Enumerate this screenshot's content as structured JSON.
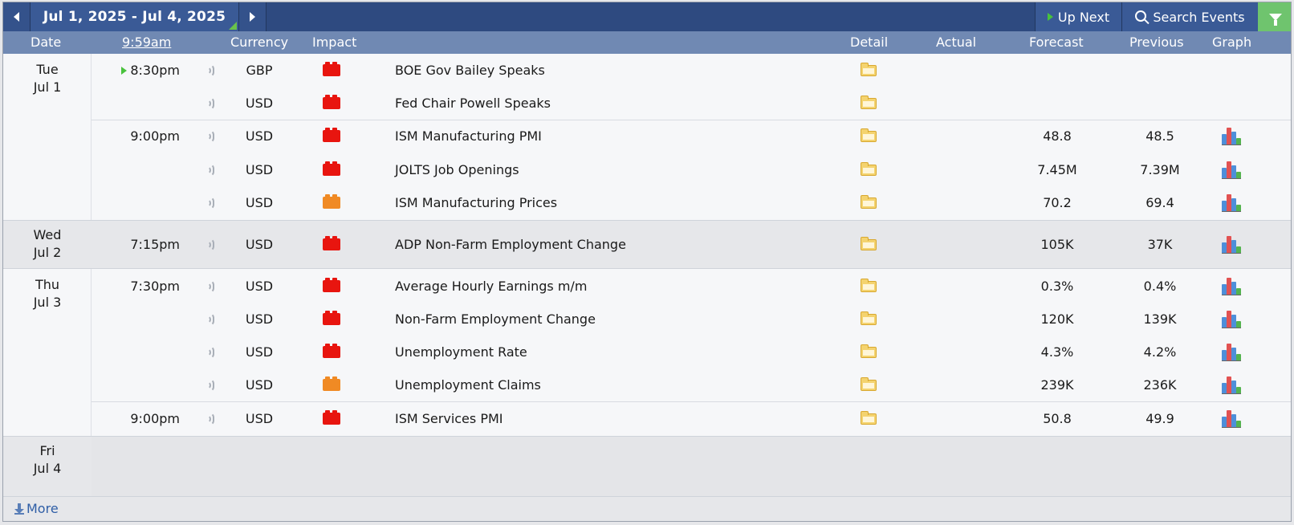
{
  "toolbar": {
    "date_range": "Jul 1, 2025 - Jul 4, 2025",
    "up_next": "Up Next",
    "search_events": "Search Events"
  },
  "header": {
    "date": "Date",
    "time": "9:59am",
    "currency": "Currency",
    "impact": "Impact",
    "detail": "Detail",
    "actual": "Actual",
    "forecast": "Forecast",
    "previous": "Previous",
    "graph": "Graph"
  },
  "days": [
    {
      "dow": "Tue",
      "date": "Jul 1"
    },
    {
      "dow": "Wed",
      "date": "Jul 2"
    },
    {
      "dow": "Thu",
      "date": "Jul 3"
    },
    {
      "dow": "Fri",
      "date": "Jul 4"
    }
  ],
  "events": [
    {
      "time": "8:30pm",
      "currency": "GBP",
      "impact": "high",
      "event": "BOE Gov Bailey Speaks",
      "actual": "",
      "forecast": "",
      "previous": "",
      "graph": false
    },
    {
      "time": "",
      "currency": "USD",
      "impact": "high",
      "event": "Fed Chair Powell Speaks",
      "actual": "",
      "forecast": "",
      "previous": "",
      "graph": false
    },
    {
      "time": "9:00pm",
      "currency": "USD",
      "impact": "high",
      "event": "ISM Manufacturing PMI",
      "actual": "",
      "forecast": "48.8",
      "previous": "48.5",
      "graph": true
    },
    {
      "time": "",
      "currency": "USD",
      "impact": "high",
      "event": "JOLTS Job Openings",
      "actual": "",
      "forecast": "7.45M",
      "previous": "7.39M",
      "graph": true
    },
    {
      "time": "",
      "currency": "USD",
      "impact": "medium",
      "event": "ISM Manufacturing Prices",
      "actual": "",
      "forecast": "70.2",
      "previous": "69.4",
      "graph": true
    },
    {
      "time": "7:15pm",
      "currency": "USD",
      "impact": "high",
      "event": "ADP Non-Farm Employment Change",
      "actual": "",
      "forecast": "105K",
      "previous": "37K",
      "graph": true
    },
    {
      "time": "7:30pm",
      "currency": "USD",
      "impact": "high",
      "event": "Average Hourly Earnings m/m",
      "actual": "",
      "forecast": "0.3%",
      "previous": "0.4%",
      "graph": true
    },
    {
      "time": "",
      "currency": "USD",
      "impact": "high",
      "event": "Non-Farm Employment Change",
      "actual": "",
      "forecast": "120K",
      "previous": "139K",
      "graph": true
    },
    {
      "time": "",
      "currency": "USD",
      "impact": "high",
      "event": "Unemployment Rate",
      "actual": "",
      "forecast": "4.3%",
      "previous": "4.2%",
      "graph": true
    },
    {
      "time": "",
      "currency": "USD",
      "impact": "medium",
      "event": "Unemployment Claims",
      "actual": "",
      "forecast": "239K",
      "previous": "236K",
      "graph": true
    },
    {
      "time": "9:00pm",
      "currency": "USD",
      "impact": "high",
      "event": "ISM Services PMI",
      "actual": "",
      "forecast": "50.8",
      "previous": "49.9",
      "graph": true
    }
  ],
  "impact_colors": {
    "high": "#e8150f",
    "medium": "#f08a24"
  },
  "more_label": "More"
}
